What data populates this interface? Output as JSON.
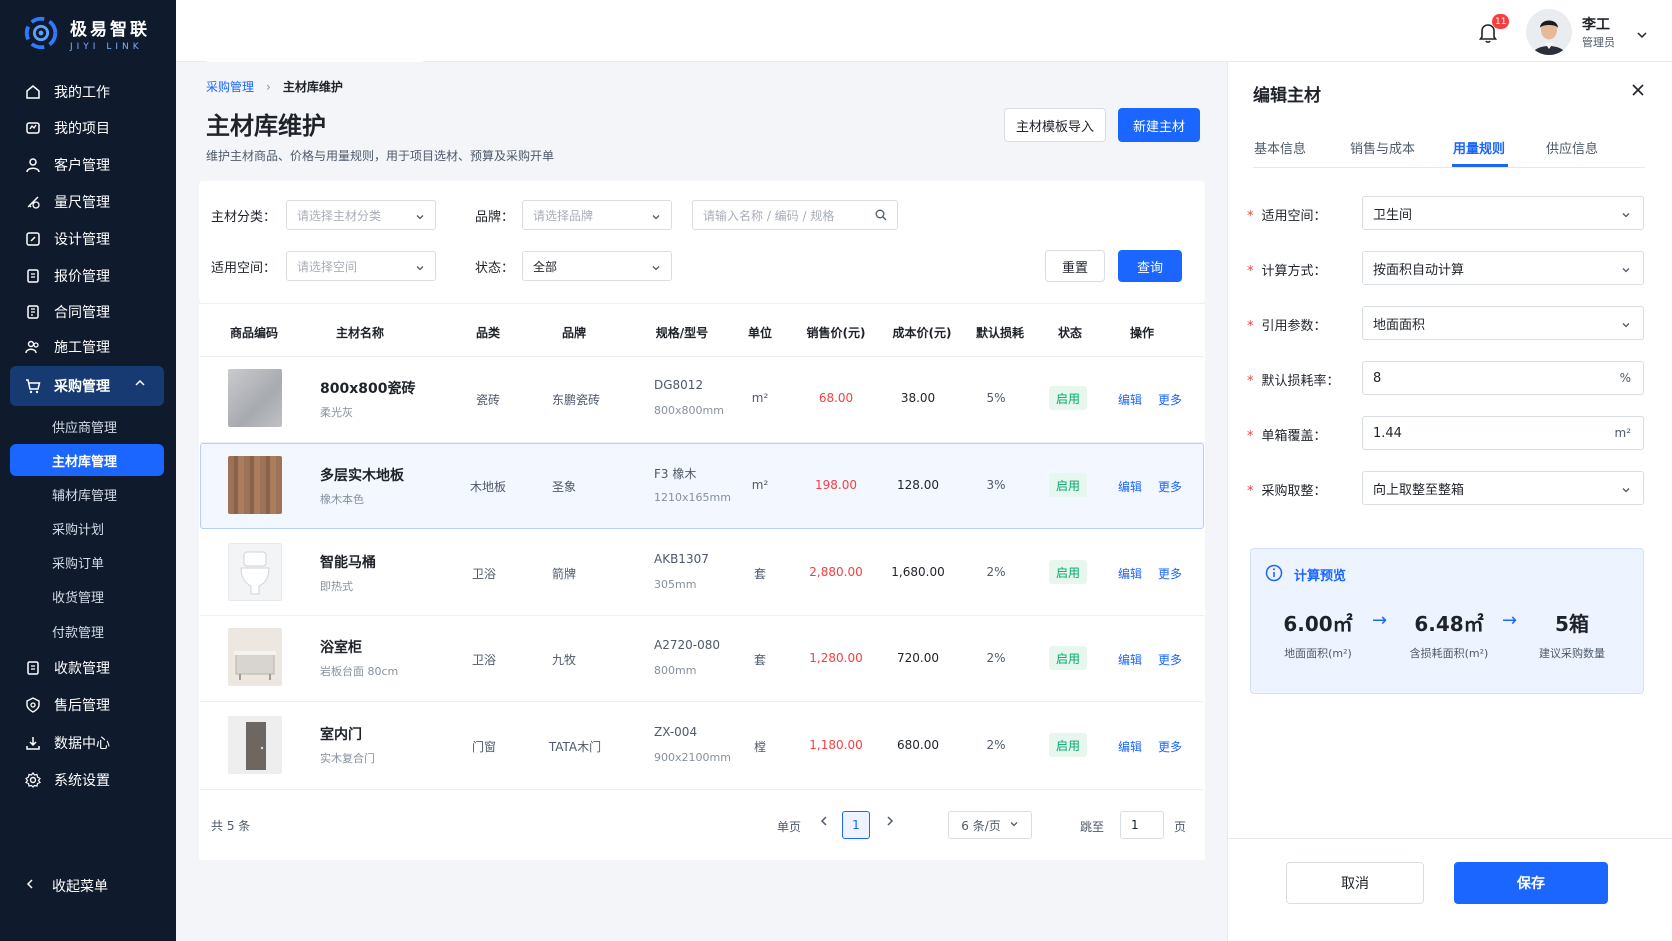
{
  "brand": {
    "name_cn": "极易智联",
    "name_en": "JIYI LINK"
  },
  "nav": {
    "items": [
      {
        "label": "我的工作",
        "icon": "home-icon"
      },
      {
        "label": "我的项目",
        "icon": "project-icon"
      },
      {
        "label": "客户管理",
        "icon": "user-icon"
      },
      {
        "label": "量尺管理",
        "icon": "ruler-icon"
      },
      {
        "label": "设计管理",
        "icon": "edit-icon"
      },
      {
        "label": "报价管理",
        "icon": "quote-icon"
      },
      {
        "label": "合同管理",
        "icon": "contract-icon"
      },
      {
        "label": "施工管理",
        "icon": "team-icon"
      },
      {
        "label": "采购管理",
        "icon": "cart-icon"
      },
      {
        "label": "收款管理",
        "icon": "receipt-icon"
      },
      {
        "label": "售后管理",
        "icon": "shield-icon"
      },
      {
        "label": "数据中心",
        "icon": "download-icon"
      },
      {
        "label": "系统设置",
        "icon": "gear-icon"
      }
    ],
    "sub_items": [
      "供应商管理",
      "主材库管理",
      "辅材库管理",
      "采购计划",
      "采购订单",
      "收货管理",
      "付款管理"
    ],
    "collapse_label": "收起菜单"
  },
  "header": {
    "notification_count": "11",
    "user_name": "李工",
    "user_role": "管理员"
  },
  "breadcrumb": {
    "parent": "采购管理",
    "current": "主材库维护"
  },
  "page": {
    "title": "主材库维护",
    "description": "维护主材商品、价格与用量规则，用于项目选材、预算及采购开单",
    "import_label": "主材模板导入",
    "new_label": "新建主材"
  },
  "filters": {
    "category_label": "主材分类：",
    "category_placeholder": "请选择主材分类",
    "brand_label": "品牌：",
    "brand_placeholder": "请选择品牌",
    "search_placeholder": "请输入名称 / 编码 / 规格",
    "space_label": "适用空间：",
    "space_placeholder": "请选择空间",
    "status_label": "状态：",
    "status_value": "全部",
    "reset_label": "重置",
    "query_label": "查询"
  },
  "table": {
    "headers": [
      "商品编码",
      "主材名称",
      "品类",
      "品牌",
      "规格/型号",
      "单位",
      "销售价(元)",
      "成本价(元)",
      "默认损耗",
      "状态",
      "操作"
    ],
    "rows": [
      {
        "name": "800x800瓷砖",
        "sub": "柔光灰",
        "category": "瓷砖",
        "brand": "东鹏瓷砖",
        "model": "DG8012",
        "spec": "800x800mm",
        "unit": "m²",
        "price": "68.00",
        "cost": "38.00",
        "loss": "5%",
        "status": "启用"
      },
      {
        "name": "多层实木地板",
        "sub": "橡木本色",
        "category": "木地板",
        "brand": "圣象",
        "model": "F3 橡木",
        "spec": "1210x165mm",
        "unit": "m²",
        "price": "198.00",
        "cost": "128.00",
        "loss": "3%",
        "status": "启用"
      },
      {
        "name": "智能马桶",
        "sub": "即热式",
        "category": "卫浴",
        "brand": "箭牌",
        "model": "AKB1307",
        "spec": "305mm",
        "unit": "套",
        "price": "2,880.00",
        "cost": "1,680.00",
        "loss": "2%",
        "status": "启用"
      },
      {
        "name": "浴室柜",
        "sub": "岩板台面 80cm",
        "category": "卫浴",
        "brand": "九牧",
        "model": "A2720-080",
        "spec": "800mm",
        "unit": "套",
        "price": "1,280.00",
        "cost": "720.00",
        "loss": "2%",
        "status": "启用"
      },
      {
        "name": "室内门",
        "sub": "实木复合门",
        "category": "门窗",
        "brand": "TATA木门",
        "model": "ZX-004",
        "spec": "900x2100mm",
        "unit": "樘",
        "price": "1,180.00",
        "cost": "680.00",
        "loss": "2%",
        "status": "启用"
      }
    ],
    "edit_label": "编辑",
    "more_label": "更多"
  },
  "pager": {
    "total": "共 5 条",
    "single_page": "单页",
    "current": "1",
    "page_size": "6 条/页",
    "jump_label": "跳至",
    "jump_value": "1",
    "page_suffix": "页"
  },
  "panel": {
    "title": "编辑主材",
    "tabs": [
      "基本信息",
      "销售与成本",
      "用量规则",
      "供应信息"
    ],
    "fields": [
      {
        "label": "适用空间：",
        "value": "卫生间",
        "type": "select"
      },
      {
        "label": "计算方式：",
        "value": "按面积自动计算",
        "type": "select"
      },
      {
        "label": "引用参数：",
        "value": "地面面积",
        "type": "select"
      },
      {
        "label": "默认损耗率：",
        "value": "8",
        "unit": "%",
        "type": "input"
      },
      {
        "label": "单箱覆盖：",
        "value": "1.44",
        "unit": "m²",
        "type": "input"
      },
      {
        "label": "采购取整：",
        "value": "向上取整至整箱",
        "type": "select"
      }
    ],
    "preview": {
      "title": "计算预览",
      "items": [
        {
          "value": "6.00㎡",
          "label": "地面面积(m²)"
        },
        {
          "value": "6.48㎡",
          "label": "含损耗面积(m²)"
        },
        {
          "value": "5箱",
          "label": "建议采购数量"
        }
      ]
    },
    "cancel_label": "取消",
    "save_label": "保存"
  }
}
